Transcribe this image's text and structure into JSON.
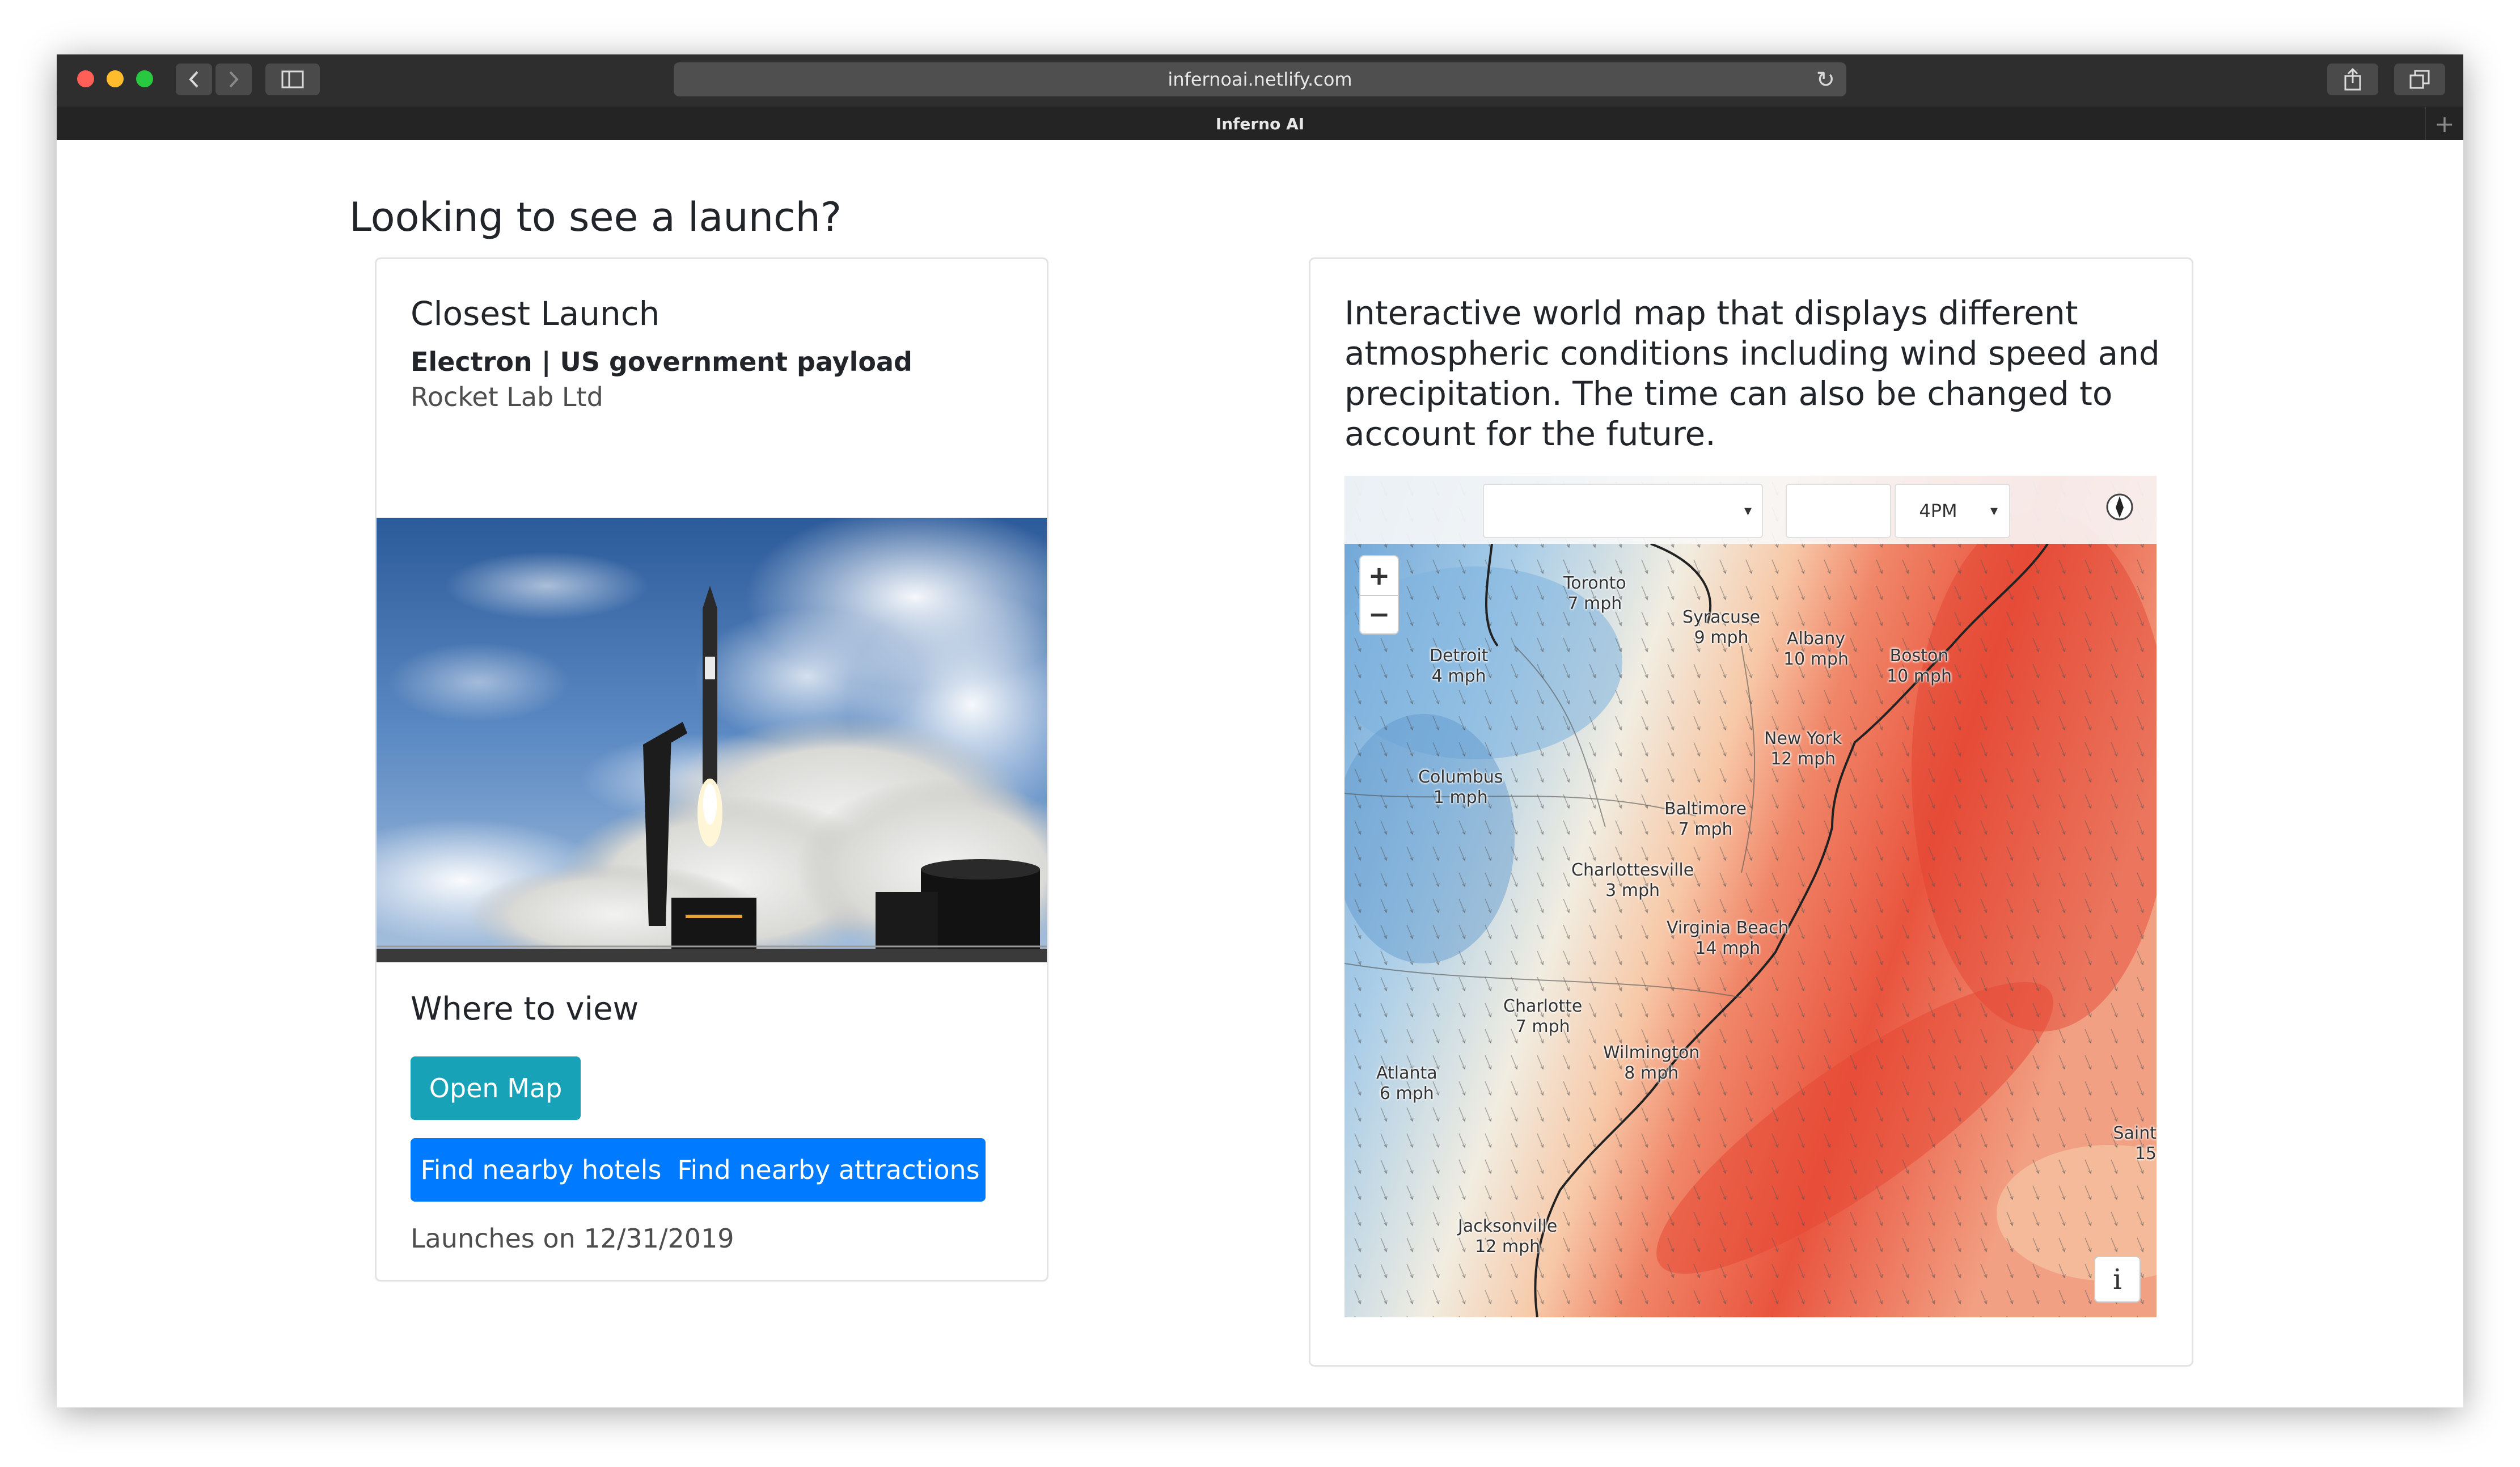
{
  "browser": {
    "url": "infernoai.netlify.com",
    "tab_title": "Inferno AI",
    "traffic_lights": {
      "close": "#ff5f57",
      "minimize": "#ffbd2e",
      "maximize": "#28c840"
    }
  },
  "page": {
    "heading": "Looking to see a launch?"
  },
  "launch_card": {
    "title": "Closest Launch",
    "vehicle_payload": "Electron | US government payload",
    "provider": "Rocket Lab Ltd",
    "where_title": "Where to view",
    "open_map_label": "Open Map",
    "hotels_label": "Find nearby hotels",
    "attractions_label": "Find nearby attractions",
    "launch_date": "Launches on 12/31/2019"
  },
  "map_card": {
    "description": "Interactive world map that displays different atmospheric conditions including wind speed and precipitation. The time can also be changed to account for the future.",
    "time_select": "4PM",
    "zoom_in": "+",
    "zoom_out": "−",
    "info": "i",
    "cities": [
      {
        "name": "Toronto",
        "value": "7 mph"
      },
      {
        "name": "Syracuse",
        "value": "9 mph"
      },
      {
        "name": "Albany",
        "value": "10 mph"
      },
      {
        "name": "Boston",
        "value": "10 mph"
      },
      {
        "name": "Detroit",
        "value": "4 mph"
      },
      {
        "name": "New York",
        "value": "12 mph"
      },
      {
        "name": "Columbus",
        "value": "1 mph"
      },
      {
        "name": "Baltimore",
        "value": "7 mph"
      },
      {
        "name": "Charlottesville",
        "value": "3 mph"
      },
      {
        "name": "Virginia Beach",
        "value": "14 mph"
      },
      {
        "name": "Charlotte",
        "value": "7 mph"
      },
      {
        "name": "Wilmington",
        "value": "8 mph"
      },
      {
        "name": "Atlanta",
        "value": "6 mph"
      },
      {
        "name": "Jacksonville",
        "value": "12 mph"
      },
      {
        "name": "Saint",
        "value": "15"
      }
    ]
  }
}
